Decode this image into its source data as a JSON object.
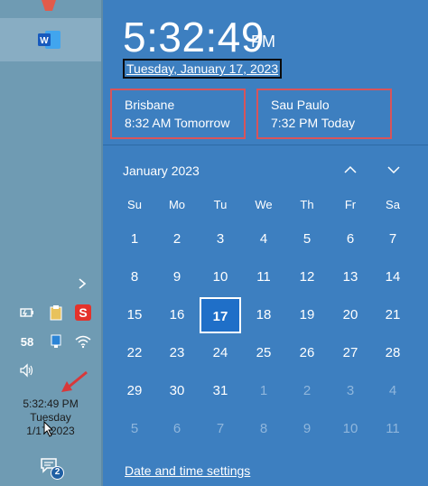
{
  "taskbar": {
    "tray_number": "58",
    "clock": {
      "time": "5:32:49 PM",
      "day": "Tuesday",
      "date": "1/17/2023"
    },
    "notifications_count": "2",
    "icons": [
      "top-app-icon",
      "word-icon",
      "show-hidden-icons-chevron",
      "battery-icon",
      "clipboard-icon",
      "s-app-icon",
      "network-device-icon",
      "wifi-icon",
      "volume-icon",
      "action-center-icon"
    ]
  },
  "flyout": {
    "time": "5:32:49",
    "ampm": "PM",
    "date_long": "Tuesday, January 17, 2023",
    "zones": [
      {
        "city": "Brisbane",
        "time": "8:32 AM Tomorrow"
      },
      {
        "city": "Sau Paulo",
        "time": "7:32 PM Today"
      }
    ],
    "month_label": "January 2023",
    "weekdays": [
      "Su",
      "Mo",
      "Tu",
      "We",
      "Th",
      "Fr",
      "Sa"
    ],
    "days": [
      [
        "1",
        "2",
        "3",
        "4",
        "5",
        "6",
        "7"
      ],
      [
        "8",
        "9",
        "10",
        "11",
        "12",
        "13",
        "14"
      ],
      [
        "15",
        "16",
        "17",
        "18",
        "19",
        "20",
        "21"
      ],
      [
        "22",
        "23",
        "24",
        "25",
        "26",
        "27",
        "28"
      ],
      [
        "29",
        "30",
        "31",
        "1",
        "2",
        "3",
        "4"
      ],
      [
        "5",
        "6",
        "7",
        "8",
        "9",
        "10",
        "11"
      ]
    ],
    "today": "17",
    "settings_link": "Date and time settings"
  },
  "colors": {
    "flyout_bg": "#3d7fc0",
    "taskbar_bg": "#6f9bb3",
    "highlight_border": "#d8545a",
    "today_bg": "#1f6fc8"
  }
}
